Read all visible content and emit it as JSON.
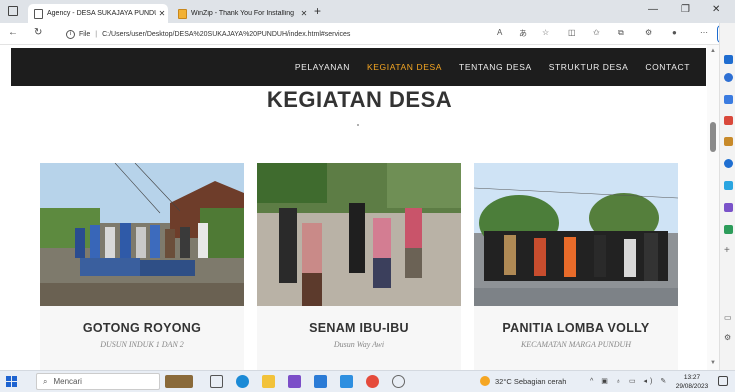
{
  "browser": {
    "tabs": [
      {
        "label": "Agency - DESA SUKAJAYA PUNDUH",
        "active": true
      },
      {
        "label": "WinZip - Thank You For Installing",
        "active": false
      }
    ],
    "url_file_label": "File",
    "url": "C:/Users/user/Desktop/DESA%20SUKAJAYA%20PUNDUH/index.html#services"
  },
  "site": {
    "nav": [
      {
        "label": "PELAYANAN",
        "active": false
      },
      {
        "label": "KEGIATAN DESA",
        "active": true
      },
      {
        "label": "TENTANG DESA",
        "active": false
      },
      {
        "label": "STRUKTUR DESA",
        "active": false
      },
      {
        "label": "CONTACT",
        "active": false
      }
    ],
    "section_title": "KEGIATAN DESA",
    "cards": [
      {
        "title": "GOTONG ROYONG",
        "subtitle": "DUSUN INDUK 1 DAN 2"
      },
      {
        "title": "SENAM IBU-IBU",
        "subtitle": "Dusun Way Awi"
      },
      {
        "title": "PANITIA LOMBA VOLLY",
        "subtitle": "KECAMATAN MARGA PUNDUH"
      }
    ]
  },
  "taskbar": {
    "search_placeholder": "Mencari",
    "weather": "32°C  Sebagian cerah",
    "time": "13:27",
    "date": "29/08/2023"
  },
  "colors": {
    "nav_bg": "#1d1d1d",
    "nav_active": "#f5a623",
    "title_text": "#333333",
    "edge_blue": "#1e6ccf"
  }
}
